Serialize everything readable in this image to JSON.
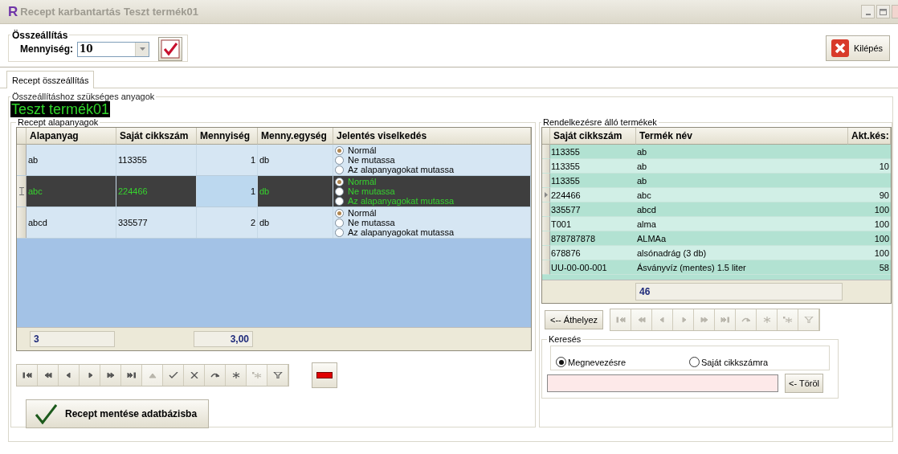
{
  "window": {
    "logo": "R",
    "title": "Recept karbantartás Teszt termék01"
  },
  "assembly": {
    "group_title": "Összeállítás",
    "quantity_label": "Mennyiség:",
    "quantity_value": "10"
  },
  "exit_button": "Kilépés",
  "tabs": [
    {
      "label": "Recept összeállítás",
      "selected": true
    }
  ],
  "materials_group": "Összeállításhoz szükséges anyagok",
  "product_title": "Teszt termék01",
  "recipe": {
    "group_title": "Recept alapanyagok",
    "columns": [
      "Alapanyag",
      "Saját cikkszám",
      "Mennyiség",
      "Menny.egység",
      "Jelentés viselkedés"
    ],
    "rows": [
      {
        "material": "ab",
        "sku": "113355",
        "quantity": "1",
        "unit": "db",
        "selected": false,
        "behaviors": [
          {
            "label": "Normál",
            "selected": true
          },
          {
            "label": "Ne mutassa",
            "selected": false
          },
          {
            "label": "Az alapanyagokat mutassa",
            "selected": false
          }
        ]
      },
      {
        "material": "abc",
        "sku": "224466",
        "quantity": "1",
        "unit": "db",
        "selected": true,
        "behaviors": [
          {
            "label": "Normál",
            "selected": true
          },
          {
            "label": "Ne mutassa",
            "selected": false
          },
          {
            "label": "Az alapanyagokat mutassa",
            "selected": false
          }
        ]
      },
      {
        "material": "abcd",
        "sku": "335577",
        "quantity": "2",
        "unit": "db",
        "selected": false,
        "behaviors": [
          {
            "label": "Normál",
            "selected": true
          },
          {
            "label": "Ne mutassa",
            "selected": false
          },
          {
            "label": "Az alapanyagokat mutassa",
            "selected": false
          }
        ]
      }
    ],
    "footer": {
      "count": "3",
      "quantity_total": "3,00"
    },
    "navigator": [
      {
        "kind": "first",
        "disabled": false
      },
      {
        "kind": "prior-page",
        "disabled": false
      },
      {
        "kind": "prior",
        "disabled": false
      },
      {
        "kind": "next",
        "disabled": false
      },
      {
        "kind": "next-page",
        "disabled": false
      },
      {
        "kind": "last",
        "disabled": false
      },
      {
        "kind": "insert",
        "disabled": true
      },
      {
        "kind": "post",
        "disabled": false
      },
      {
        "kind": "cancel",
        "disabled": false
      },
      {
        "kind": "refresh",
        "disabled": false
      },
      {
        "kind": "star",
        "disabled": false
      },
      {
        "kind": "star-clear",
        "disabled": true
      },
      {
        "kind": "filter",
        "disabled": false
      }
    ],
    "save_button": "Recept mentése adatbázisba"
  },
  "products": {
    "group_title": "Rendelkezésre álló termékek",
    "columns": [
      "Saját cikkszám",
      "Termék név",
      "Akt.kés:"
    ],
    "rows": [
      {
        "sku": "113355",
        "name": "ab",
        "stock": "",
        "current": false
      },
      {
        "sku": "113355",
        "name": "ab",
        "stock": "10",
        "current": false
      },
      {
        "sku": "113355",
        "name": "ab",
        "stock": "",
        "current": false
      },
      {
        "sku": "224466",
        "name": "abc",
        "stock": "90",
        "current": true
      },
      {
        "sku": "335577",
        "name": "abcd",
        "stock": "100",
        "current": false
      },
      {
        "sku": "T001",
        "name": "alma",
        "stock": "100",
        "current": false
      },
      {
        "sku": "878787878",
        "name": "ALMAa",
        "stock": "100",
        "current": false
      },
      {
        "sku": "678876",
        "name": "alsónadrág (3 db)",
        "stock": "100",
        "current": false
      },
      {
        "sku": "UU-00-00-001",
        "name": "Ásványvíz (mentes) 1.5 liter",
        "stock": "58",
        "current": false
      }
    ],
    "footer": {
      "count": "46"
    },
    "move_button": "<-- Áthelyez",
    "navigator": [
      {
        "kind": "first",
        "disabled": true
      },
      {
        "kind": "prior-page",
        "disabled": true
      },
      {
        "kind": "prior",
        "disabled": true
      },
      {
        "kind": "next",
        "disabled": true
      },
      {
        "kind": "next-page",
        "disabled": true
      },
      {
        "kind": "last",
        "disabled": true
      },
      {
        "kind": "refresh",
        "disabled": true
      },
      {
        "kind": "star",
        "disabled": true
      },
      {
        "kind": "star-clear",
        "disabled": true
      },
      {
        "kind": "filter",
        "disabled": true
      }
    ],
    "search": {
      "group_title": "Keresés",
      "options": [
        {
          "label": "Megnevezésre",
          "selected": true
        },
        {
          "label": "Saját cikkszámra",
          "selected": false
        }
      ],
      "clear_button": "<- Töröl"
    }
  }
}
